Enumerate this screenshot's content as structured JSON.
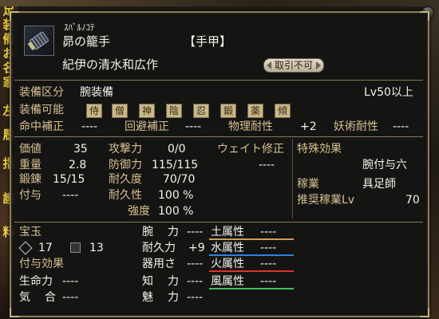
{
  "background": {
    "left_strip": [
      "足",
      "装",
      "備",
      "お",
      "名",
      "家",
      "左",
      "履",
      "指",
      "護",
      "料"
    ]
  },
  "item": {
    "furigana": "ｽﾊﾞﾙﾉｺﾃ",
    "name": "昴の籠手",
    "type": "【手甲】",
    "maker": "紀伊の清水和広作",
    "trade_seal": "取引不可"
  },
  "equip": {
    "category_label": "装備区分",
    "category_value": "腕装備",
    "level_req": "Lv50以上",
    "jobs_label": "装備可能",
    "jobs": [
      "侍",
      "僧",
      "神",
      "陰",
      "忍",
      "鍛",
      "薬",
      "傾"
    ]
  },
  "corrections": {
    "hit_label": "命中補正",
    "hit_value": "----",
    "evade_label": "回避補正",
    "evade_value": "----",
    "phys_label": "物理耐性",
    "phys_value": "+2",
    "magic_label": "妖術耐性",
    "magic_value": "----"
  },
  "stats": {
    "price_label": "価値",
    "price_value": "35",
    "weight_label": "重量",
    "weight_value": "2.8",
    "forge_label": "鍛錬",
    "forge_value": "15/15",
    "imbue_label": "付与",
    "imbue_value": "----",
    "attack_label": "攻撃力",
    "attack_value": "0/0",
    "defense_label": "防御力",
    "defense_value": "115/115",
    "durability_label": "耐久度",
    "durability_value": "70/70",
    "endurance_label": "耐久性",
    "endurance_value": "100 %",
    "strength_label": "強度",
    "strength_value": "100 %",
    "weight_mod_label": "ウェイト修正",
    "weight_mod_value": "----"
  },
  "special": {
    "title": "特殊効果",
    "effect": "腕付与六",
    "job_label": "稼業",
    "job_value": "具足師",
    "rec_label": "推奨稼業Lv",
    "rec_value": "70"
  },
  "gems": {
    "label": "宝玉",
    "slot1_value": "17",
    "slot2_value": "13"
  },
  "attributes": {
    "arm_label": "腕",
    "arm_label2": "力",
    "arm_value": "----",
    "stam_label": "耐久力",
    "stam_value": "+9",
    "dex_label": "器用さ",
    "dex_value": "----",
    "int_label": "知",
    "int_label2": "力",
    "int_value": "----",
    "charm_label": "魅",
    "charm_label2": "力",
    "charm_value": "----"
  },
  "elements": {
    "earth_label": "土属性",
    "earth_value": "----",
    "earth_color": "#c8a060",
    "water_label": "水属性",
    "water_value": "----",
    "water_color": "#3080e0",
    "fire_label": "火属性",
    "fire_value": "----",
    "fire_color": "#e03030",
    "wind_label": "風属性",
    "wind_value": "----",
    "wind_color": "#40c060"
  },
  "imbue_effects": {
    "title": "付与効果",
    "life_label": "生命力",
    "life_value": "----",
    "ki_label1": "気",
    "ki_label2": "合",
    "ki_value": "----"
  }
}
